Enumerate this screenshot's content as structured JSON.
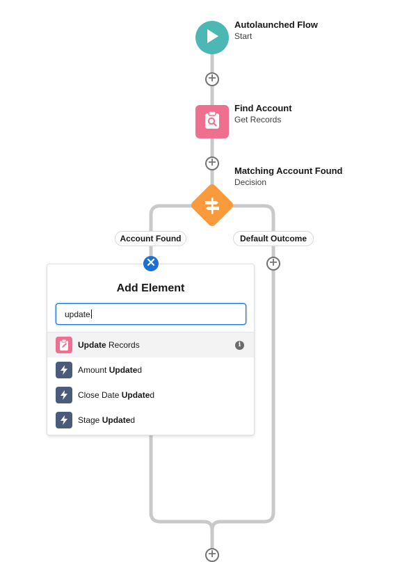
{
  "flow": {
    "start": {
      "title": "Autolaunched Flow",
      "subtitle": "Start",
      "icon": "play-icon",
      "color": "#4bb8b5"
    },
    "get_records": {
      "title": "Find Account",
      "subtitle": "Get Records",
      "icon": "clipboard-search-icon",
      "color": "#ef6f8f"
    },
    "decision": {
      "title": "Matching Account Found",
      "subtitle": "Decision",
      "icon": "decision-icon",
      "color": "#f99a3c"
    },
    "outcomes": [
      {
        "label": "Account Found"
      },
      {
        "label": "Default Outcome"
      }
    ]
  },
  "add_element_panel": {
    "title": "Add Element",
    "search_value": "update",
    "results": [
      {
        "pre": "",
        "match": "Update",
        "post": " Records",
        "icon": "clipboard-edit-icon",
        "color": "#ef6f8f",
        "selected": true,
        "info": "i"
      },
      {
        "pre": "Amount ",
        "match": "Update",
        "post": "d",
        "icon": "lightning-icon",
        "color": "#4a5b7b",
        "selected": false
      },
      {
        "pre": "Close Date ",
        "match": "Update",
        "post": "d",
        "icon": "lightning-icon",
        "color": "#4a5b7b",
        "selected": false
      },
      {
        "pre": "Stage ",
        "match": "Update",
        "post": "d",
        "icon": "lightning-icon",
        "color": "#4a5b7b",
        "selected": false
      }
    ]
  },
  "colors": {
    "connector": "#c9c9c9",
    "accent": "#1b6fd6"
  }
}
